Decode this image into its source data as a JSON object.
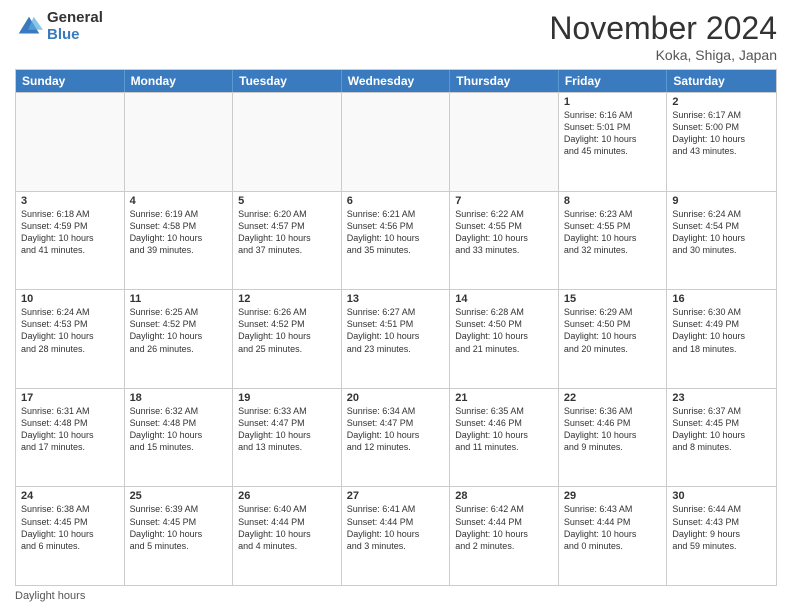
{
  "logo": {
    "general": "General",
    "blue": "Blue"
  },
  "title": "November 2024",
  "location": "Koka, Shiga, Japan",
  "days_of_week": [
    "Sunday",
    "Monday",
    "Tuesday",
    "Wednesday",
    "Thursday",
    "Friday",
    "Saturday"
  ],
  "footer": "Daylight hours",
  "weeks": [
    [
      {
        "day": "",
        "info": ""
      },
      {
        "day": "",
        "info": ""
      },
      {
        "day": "",
        "info": ""
      },
      {
        "day": "",
        "info": ""
      },
      {
        "day": "",
        "info": ""
      },
      {
        "day": "1",
        "info": "Sunrise: 6:16 AM\nSunset: 5:01 PM\nDaylight: 10 hours\nand 45 minutes."
      },
      {
        "day": "2",
        "info": "Sunrise: 6:17 AM\nSunset: 5:00 PM\nDaylight: 10 hours\nand 43 minutes."
      }
    ],
    [
      {
        "day": "3",
        "info": "Sunrise: 6:18 AM\nSunset: 4:59 PM\nDaylight: 10 hours\nand 41 minutes."
      },
      {
        "day": "4",
        "info": "Sunrise: 6:19 AM\nSunset: 4:58 PM\nDaylight: 10 hours\nand 39 minutes."
      },
      {
        "day": "5",
        "info": "Sunrise: 6:20 AM\nSunset: 4:57 PM\nDaylight: 10 hours\nand 37 minutes."
      },
      {
        "day": "6",
        "info": "Sunrise: 6:21 AM\nSunset: 4:56 PM\nDaylight: 10 hours\nand 35 minutes."
      },
      {
        "day": "7",
        "info": "Sunrise: 6:22 AM\nSunset: 4:55 PM\nDaylight: 10 hours\nand 33 minutes."
      },
      {
        "day": "8",
        "info": "Sunrise: 6:23 AM\nSunset: 4:55 PM\nDaylight: 10 hours\nand 32 minutes."
      },
      {
        "day": "9",
        "info": "Sunrise: 6:24 AM\nSunset: 4:54 PM\nDaylight: 10 hours\nand 30 minutes."
      }
    ],
    [
      {
        "day": "10",
        "info": "Sunrise: 6:24 AM\nSunset: 4:53 PM\nDaylight: 10 hours\nand 28 minutes."
      },
      {
        "day": "11",
        "info": "Sunrise: 6:25 AM\nSunset: 4:52 PM\nDaylight: 10 hours\nand 26 minutes."
      },
      {
        "day": "12",
        "info": "Sunrise: 6:26 AM\nSunset: 4:52 PM\nDaylight: 10 hours\nand 25 minutes."
      },
      {
        "day": "13",
        "info": "Sunrise: 6:27 AM\nSunset: 4:51 PM\nDaylight: 10 hours\nand 23 minutes."
      },
      {
        "day": "14",
        "info": "Sunrise: 6:28 AM\nSunset: 4:50 PM\nDaylight: 10 hours\nand 21 minutes."
      },
      {
        "day": "15",
        "info": "Sunrise: 6:29 AM\nSunset: 4:50 PM\nDaylight: 10 hours\nand 20 minutes."
      },
      {
        "day": "16",
        "info": "Sunrise: 6:30 AM\nSunset: 4:49 PM\nDaylight: 10 hours\nand 18 minutes."
      }
    ],
    [
      {
        "day": "17",
        "info": "Sunrise: 6:31 AM\nSunset: 4:48 PM\nDaylight: 10 hours\nand 17 minutes."
      },
      {
        "day": "18",
        "info": "Sunrise: 6:32 AM\nSunset: 4:48 PM\nDaylight: 10 hours\nand 15 minutes."
      },
      {
        "day": "19",
        "info": "Sunrise: 6:33 AM\nSunset: 4:47 PM\nDaylight: 10 hours\nand 13 minutes."
      },
      {
        "day": "20",
        "info": "Sunrise: 6:34 AM\nSunset: 4:47 PM\nDaylight: 10 hours\nand 12 minutes."
      },
      {
        "day": "21",
        "info": "Sunrise: 6:35 AM\nSunset: 4:46 PM\nDaylight: 10 hours\nand 11 minutes."
      },
      {
        "day": "22",
        "info": "Sunrise: 6:36 AM\nSunset: 4:46 PM\nDaylight: 10 hours\nand 9 minutes."
      },
      {
        "day": "23",
        "info": "Sunrise: 6:37 AM\nSunset: 4:45 PM\nDaylight: 10 hours\nand 8 minutes."
      }
    ],
    [
      {
        "day": "24",
        "info": "Sunrise: 6:38 AM\nSunset: 4:45 PM\nDaylight: 10 hours\nand 6 minutes."
      },
      {
        "day": "25",
        "info": "Sunrise: 6:39 AM\nSunset: 4:45 PM\nDaylight: 10 hours\nand 5 minutes."
      },
      {
        "day": "26",
        "info": "Sunrise: 6:40 AM\nSunset: 4:44 PM\nDaylight: 10 hours\nand 4 minutes."
      },
      {
        "day": "27",
        "info": "Sunrise: 6:41 AM\nSunset: 4:44 PM\nDaylight: 10 hours\nand 3 minutes."
      },
      {
        "day": "28",
        "info": "Sunrise: 6:42 AM\nSunset: 4:44 PM\nDaylight: 10 hours\nand 2 minutes."
      },
      {
        "day": "29",
        "info": "Sunrise: 6:43 AM\nSunset: 4:44 PM\nDaylight: 10 hours\nand 0 minutes."
      },
      {
        "day": "30",
        "info": "Sunrise: 6:44 AM\nSunset: 4:43 PM\nDaylight: 9 hours\nand 59 minutes."
      }
    ]
  ]
}
